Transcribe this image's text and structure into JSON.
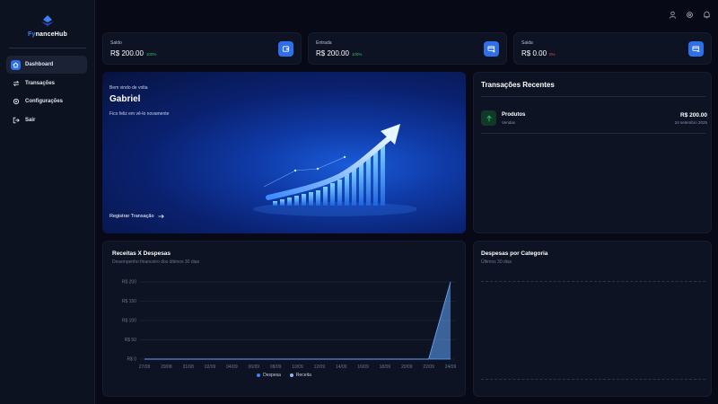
{
  "brand": {
    "name_prefix": "Fy",
    "name_suffix": "nanceHub"
  },
  "nav": [
    {
      "label": "Dashboard",
      "icon": "home-icon",
      "active": true
    },
    {
      "label": "Transações",
      "icon": "transfer-icon",
      "active": false
    },
    {
      "label": "Configurações",
      "icon": "gear-icon",
      "active": false
    },
    {
      "label": "Sair",
      "icon": "logout-icon",
      "active": false
    }
  ],
  "header_icons": [
    "user-icon",
    "gear-icon",
    "bell-icon"
  ],
  "stats": [
    {
      "label": "Saldo",
      "value": "R$ 200.00",
      "percent": "100%",
      "trend": "positive",
      "icon": "wallet-icon"
    },
    {
      "label": "Entrada",
      "value": "R$ 200.00",
      "percent": "100%",
      "trend": "positive",
      "icon": "card-income-icon"
    },
    {
      "label": "Saida",
      "value": "R$ 0.00",
      "percent": "0%",
      "trend": "negative",
      "icon": "card-expense-icon"
    }
  ],
  "hero": {
    "greeting": "Bem vindo de volta",
    "name": "Gabriel",
    "subtitle": "Fico feliz em vê-lo novamente",
    "cta": "Registrar Transação"
  },
  "recent": {
    "title": "Transações Recentes",
    "items": [
      {
        "name": "Produtos",
        "category": "Vendas",
        "amount": "R$ 200.00",
        "date": "24 setembro 2025",
        "icon": "arrow-up-icon"
      }
    ]
  },
  "revenue_chart": {
    "title": "Receitas X Despesas",
    "subtitle": "Desempenho financeiro dos últimos 30 dias",
    "legend": [
      "Despesa",
      "Receita"
    ]
  },
  "category_chart": {
    "title": "Despesas por Categoria",
    "subtitle": "Últimos 30 dias"
  },
  "colors": {
    "accent": "#2f6fe8",
    "positive": "#22c55e",
    "negative": "#ef4444",
    "despesa": "#3b82f6",
    "receita": "#60a5fa"
  },
  "chart_data": [
    {
      "type": "area",
      "title": "Receitas X Despesas",
      "xlabel": "",
      "ylabel": "",
      "categories": [
        "27/08",
        "29/08",
        "31/08",
        "02/09",
        "04/09",
        "06/09",
        "08/09",
        "10/09",
        "12/09",
        "14/09",
        "16/09",
        "18/09",
        "20/09",
        "22/09",
        "24/09"
      ],
      "y_ticks": [
        "R$ 0",
        "R$ 50",
        "R$ 100",
        "R$ 150",
        "R$ 200"
      ],
      "ylim": [
        0,
        200
      ],
      "grid": true,
      "legend_position": "bottom",
      "series": [
        {
          "name": "Despesa",
          "values": [
            0,
            0,
            0,
            0,
            0,
            0,
            0,
            0,
            0,
            0,
            0,
            0,
            0,
            0,
            0
          ]
        },
        {
          "name": "Receita",
          "values": [
            0,
            0,
            0,
            0,
            0,
            0,
            0,
            0,
            0,
            0,
            0,
            0,
            0,
            0,
            200
          ]
        }
      ]
    }
  ]
}
